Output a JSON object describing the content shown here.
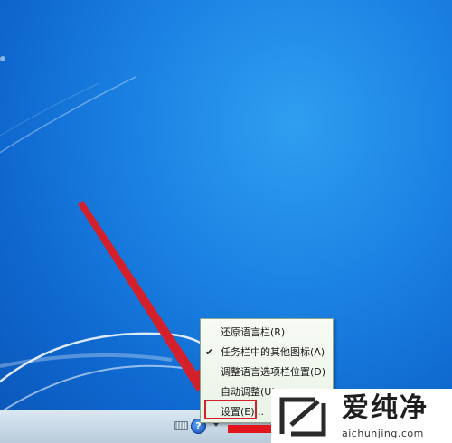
{
  "context_menu": {
    "items": [
      {
        "label": "还原语言栏(R)",
        "checked": false
      },
      {
        "label": "任务栏中的其他图标(A)",
        "checked": true
      },
      {
        "label": "调整语言选项栏位置(D)",
        "checked": false
      },
      {
        "label": "自动调整(U)",
        "checked": false
      },
      {
        "label": "设置(E)...",
        "checked": false,
        "highlighted": true
      }
    ],
    "check_mark": "✔"
  },
  "tray": {
    "help_glyph": "?",
    "icons": [
      "keyboard-icon",
      "help-icon",
      "menu-arrow-icon"
    ]
  },
  "watermark": {
    "title": "爱纯净",
    "url": "aichunjing.com"
  },
  "colors": {
    "desktop_blue": "#1b82e3",
    "annotation_red": "#d3202a",
    "menu_background": "#f2f8ef"
  }
}
